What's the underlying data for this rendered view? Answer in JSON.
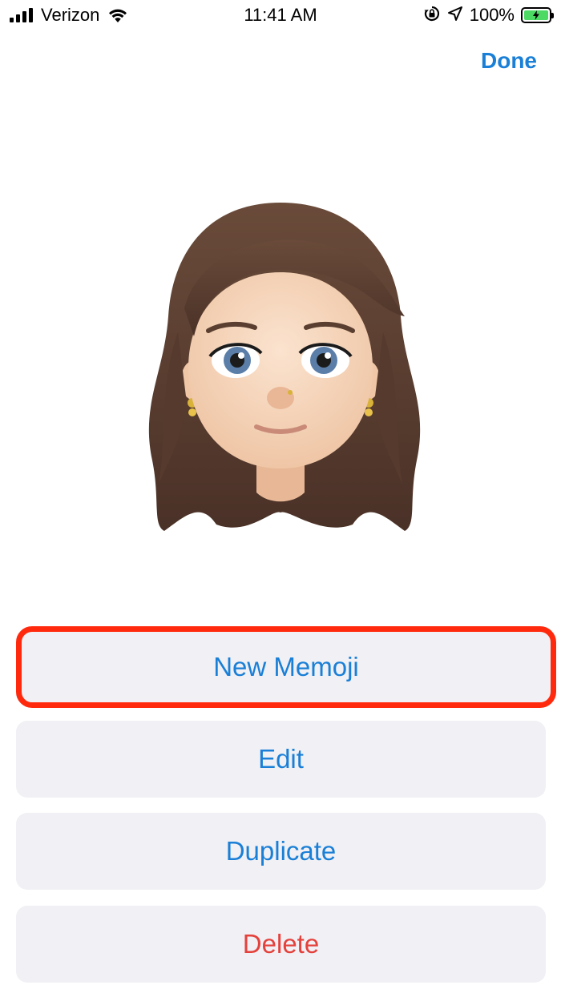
{
  "status_bar": {
    "carrier": "Verizon",
    "time": "11:41 AM",
    "battery_percent": "100%",
    "battery_color": "#4cd964"
  },
  "nav": {
    "done_label": "Done"
  },
  "actions": {
    "new_memoji": "New Memoji",
    "edit": "Edit",
    "duplicate": "Duplicate",
    "delete": "Delete"
  },
  "colors": {
    "accent": "#1a7fd6",
    "destructive": "#e5413b",
    "highlight": "#ff2a0d",
    "button_bg": "#f0f0f5"
  }
}
